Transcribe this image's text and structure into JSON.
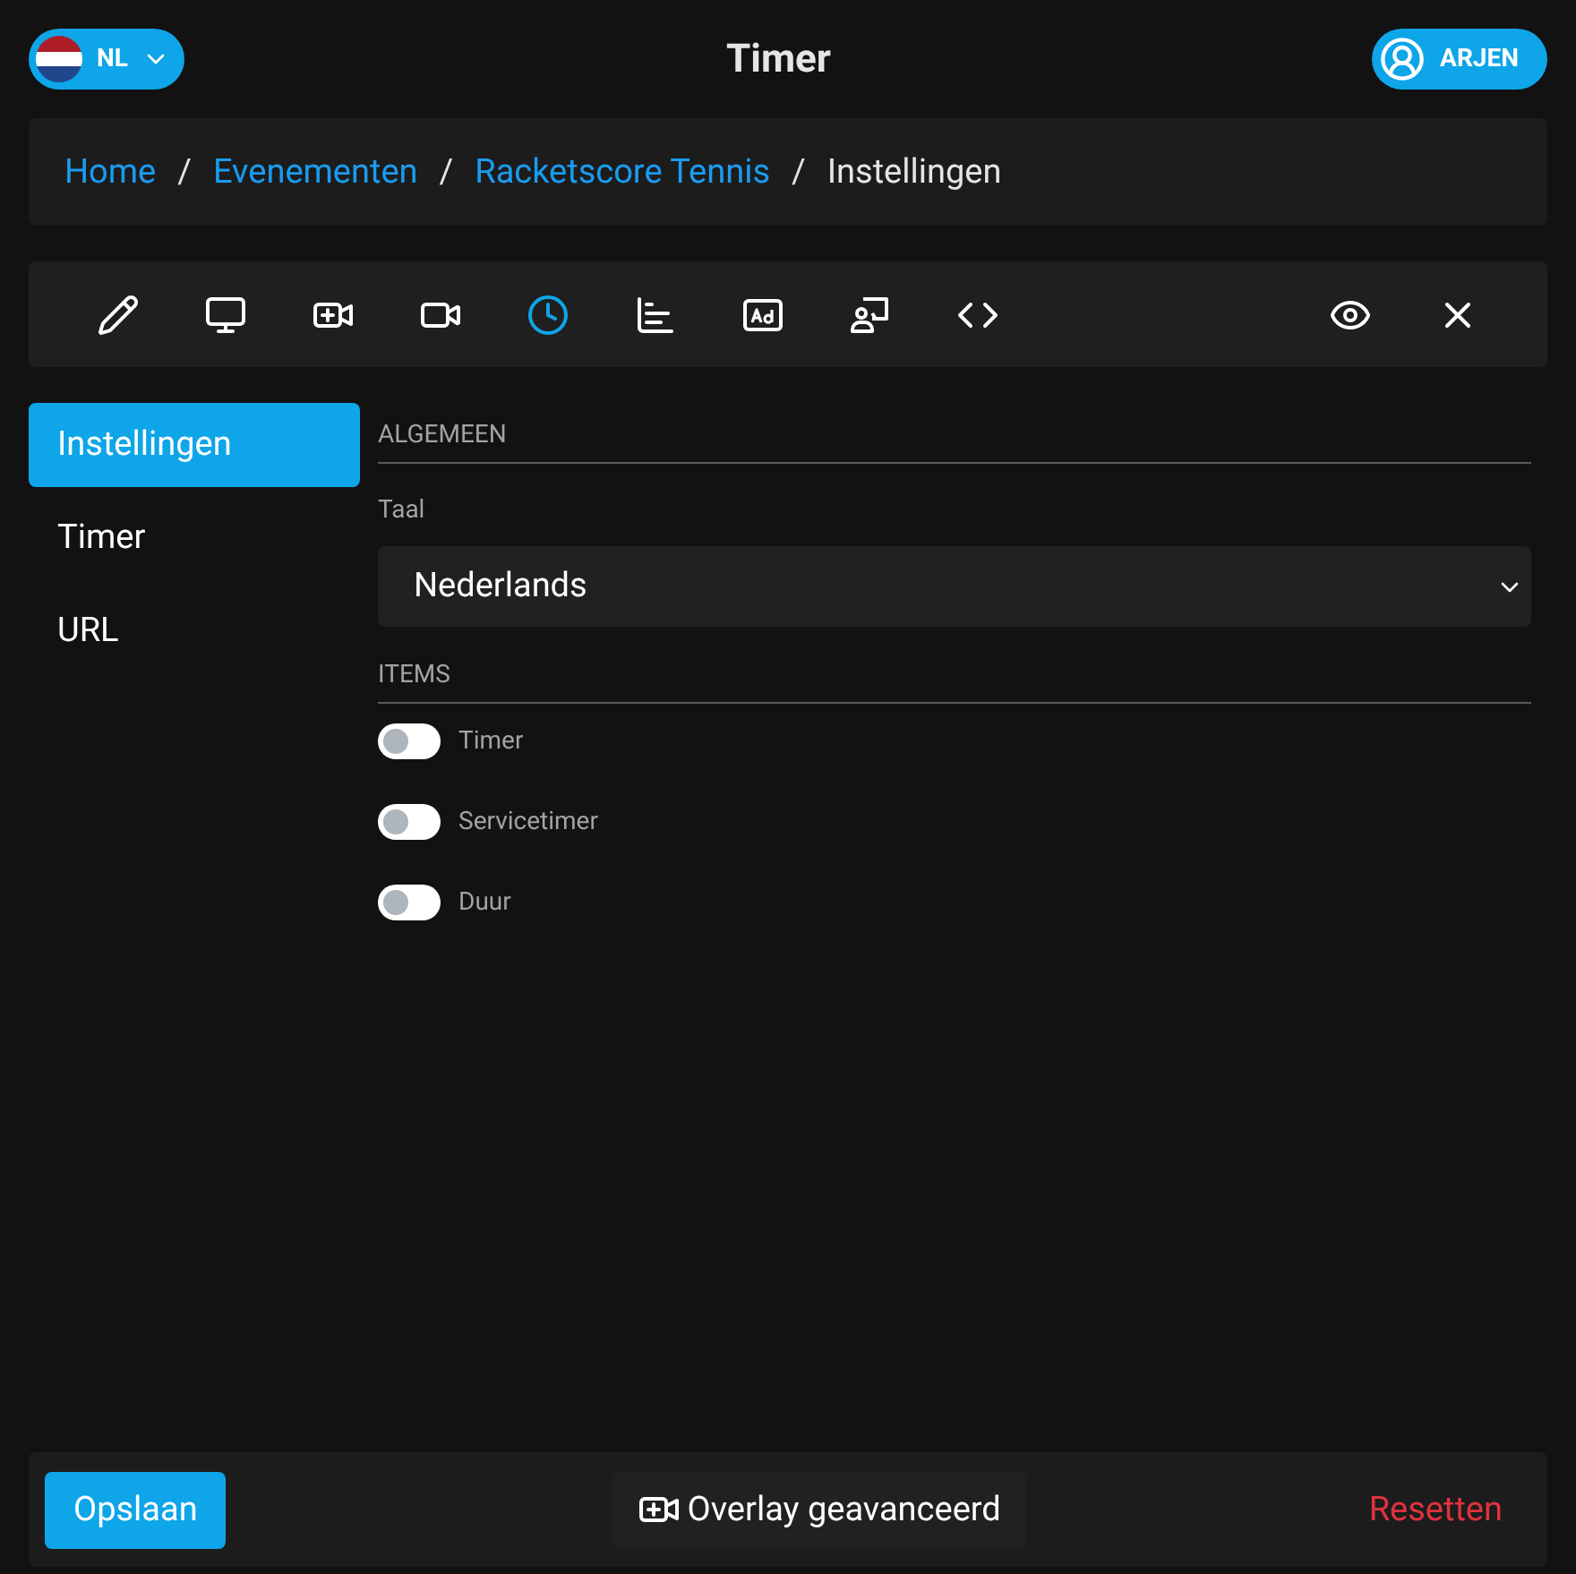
{
  "header": {
    "language": "NL",
    "title": "Timer",
    "user": "ARJEN"
  },
  "breadcrumb": [
    {
      "label": "Home",
      "link": true
    },
    {
      "label": "Evenementen",
      "link": true
    },
    {
      "label": "Racketscore Tennis",
      "link": true
    },
    {
      "label": "Instellingen",
      "link": false
    }
  ],
  "breadcrumb_separator": "/",
  "toolbar": [
    {
      "kind": "pencil",
      "selected": false
    },
    {
      "kind": "monitor",
      "selected": false
    },
    {
      "kind": "video-plus",
      "selected": false
    },
    {
      "kind": "video",
      "selected": false
    },
    {
      "kind": "clock",
      "selected": true
    },
    {
      "kind": "chart",
      "selected": false
    },
    {
      "kind": "ad",
      "selected": false
    },
    {
      "kind": "presenter",
      "selected": false
    },
    {
      "kind": "code",
      "selected": false
    }
  ],
  "toolbar_right": [
    {
      "kind": "eye"
    },
    {
      "kind": "close"
    }
  ],
  "sidebar": {
    "items": [
      {
        "label": "Instellingen",
        "selected": true
      },
      {
        "label": "Timer",
        "selected": false
      },
      {
        "label": "URL",
        "selected": false
      }
    ]
  },
  "general": {
    "heading": "ALGEMEEN",
    "language_label": "Taal",
    "language_value": "Nederlands"
  },
  "items": {
    "heading": "ITEMS",
    "toggles": [
      {
        "label": "Timer",
        "on": false
      },
      {
        "label": "Servicetimer",
        "on": false
      },
      {
        "label": "Duur",
        "on": false
      }
    ]
  },
  "footer": {
    "save": "Opslaan",
    "overlay": "Overlay geavanceerd",
    "reset": "Resetten"
  }
}
